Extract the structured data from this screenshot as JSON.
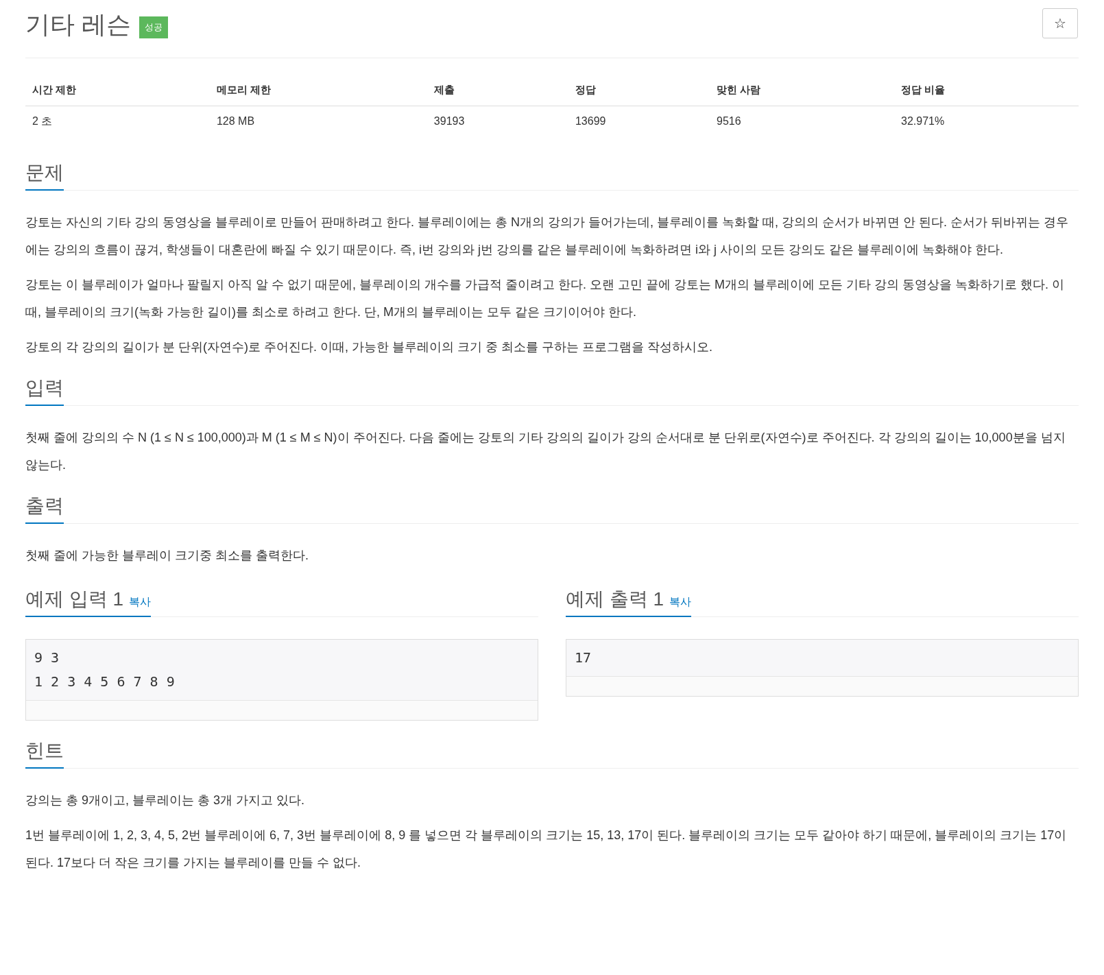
{
  "title": "기타 레슨",
  "badge": "성공",
  "star_button": "☆",
  "stats": {
    "columns": [
      "시간 제한",
      "메모리 제한",
      "제출",
      "정답",
      "맞힌 사람",
      "정답 비율"
    ],
    "values": [
      "2 초",
      "128 MB",
      "39193",
      "13699",
      "9516",
      "32.971%"
    ]
  },
  "problem": {
    "heading": "문제",
    "paragraphs": [
      "강토는 자신의 기타 강의 동영상을 블루레이로 만들어 판매하려고 한다. 블루레이에는 총 N개의 강의가 들어가는데, 블루레이를 녹화할 때, 강의의 순서가 바뀌면 안 된다. 순서가 뒤바뀌는 경우에는 강의의 흐름이 끊겨, 학생들이 대혼란에 빠질 수 있기 때문이다. 즉, i번 강의와 j번 강의를 같은 블루레이에 녹화하려면 i와 j 사이의 모든 강의도 같은 블루레이에 녹화해야 한다.",
      "강토는 이 블루레이가 얼마나 팔릴지 아직 알 수 없기 때문에, 블루레이의 개수를 가급적 줄이려고 한다. 오랜 고민 끝에 강토는 M개의 블루레이에 모든 기타 강의 동영상을 녹화하기로 했다. 이때, 블루레이의 크기(녹화 가능한 길이)를 최소로 하려고 한다. 단, M개의 블루레이는 모두 같은 크기이어야 한다.",
      "강토의 각 강의의 길이가 분 단위(자연수)로 주어진다. 이때, 가능한 블루레이의 크기 중 최소를 구하는 프로그램을 작성하시오."
    ]
  },
  "input": {
    "heading": "입력",
    "paragraphs": [
      "첫째 줄에 강의의 수 N (1 ≤ N ≤ 100,000)과 M (1 ≤ M ≤ N)이 주어진다. 다음 줄에는 강토의 기타 강의의 길이가 강의 순서대로 분 단위로(자연수)로 주어진다. 각 강의의 길이는 10,000분을 넘지 않는다."
    ]
  },
  "output": {
    "heading": "출력",
    "paragraphs": [
      "첫째 줄에 가능한 블루레이 크기중 최소를 출력한다."
    ]
  },
  "samples": [
    {
      "heading": "예제 입력 1",
      "copy": "복사",
      "content": "9 3\n1 2 3 4 5 6 7 8 9"
    },
    {
      "heading": "예제 출력 1",
      "copy": "복사",
      "content": "17"
    }
  ],
  "hint": {
    "heading": "힌트",
    "paragraphs": [
      "강의는 총 9개이고, 블루레이는 총 3개 가지고 있다.",
      "1번 블루레이에 1, 2, 3, 4, 5, 2번 블루레이에 6, 7, 3번 블루레이에 8, 9 를 넣으면 각 블루레이의 크기는 15, 13, 17이 된다. 블루레이의 크기는 모두 같아야 하기 때문에, 블루레이의 크기는 17이 된다. 17보다 더 작은 크기를 가지는 블루레이를 만들 수 없다."
    ]
  }
}
